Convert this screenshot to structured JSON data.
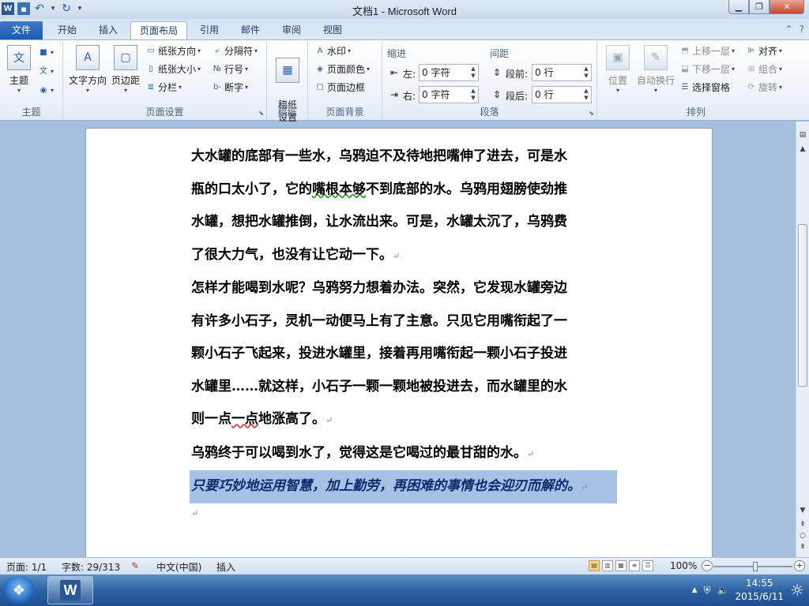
{
  "app": {
    "title": "文档1 - Microsoft Word",
    "logo_letter": "W"
  },
  "tabs": [
    "文件",
    "开始",
    "插入",
    "页面布局",
    "引用",
    "邮件",
    "审阅",
    "视图"
  ],
  "ribbon": {
    "theme": {
      "label": "主题",
      "group": "主题"
    },
    "page_setup": {
      "group": "页面设置",
      "text_direction": "文字方向",
      "margins": "页边距",
      "orientation": "纸张方向",
      "size": "纸张大小",
      "columns": "分栏",
      "breaks": "分隔符",
      "line_numbers": "行号",
      "hyphenation": "断字"
    },
    "manuscript": {
      "group": "稿纸",
      "button": "稿纸\n设置"
    },
    "page_background": {
      "group": "页面背景",
      "watermark": "水印",
      "page_color": "页面颜色",
      "page_borders": "页面边框"
    },
    "paragraph": {
      "group": "段落",
      "indent_head": "缩进",
      "spacing_head": "间距",
      "left_label": "左:",
      "right_label": "右:",
      "before_label": "段前:",
      "after_label": "段后:",
      "left_value": "0 字符",
      "right_value": "0 字符",
      "before_value": "0 行",
      "after_value": "0 行"
    },
    "arrange": {
      "group": "排列",
      "position": "位置",
      "wrap": "自动换行",
      "bring_forward": "上移一层",
      "send_backward": "下移一层",
      "selection_pane": "选择窗格",
      "align": "对齐",
      "group_btn": "组合",
      "rotate": "旋转"
    }
  },
  "document": {
    "lines_p1": [
      "大水罐的底部有一些水，乌鸦迫不及待地把嘴伸了进去，可是水",
      "瓶的口太小了，它的",
      "嘴根本够",
      "不到底部的水。乌鸦用翅膀使劲推",
      "水罐，想把水罐推倒，让水流出来。可是，水罐太沉了，乌鸦费",
      "了很大力气，也没有让它动一下。"
    ],
    "lines_p2": [
      "怎样才能喝到水呢？乌鸦努力想着办法。突然，它发现水罐旁边",
      "有许多小石子，灵机一动便马上有了主意。只见它用嘴衔起了一",
      "颗小石子飞起来，投进水罐里，接着再用嘴衔起一颗小石子投进",
      "水罐里……就这样，小石子一颗一颗地被投进去，而水罐里的水",
      "则一点",
      "一点",
      "地涨高了。"
    ],
    "p3": "乌鸦终于可以喝到水了，觉得这是它喝过的最甘甜的水。",
    "p4": "只要巧妙地运用智慧，加上勤劳，再困难的事情也会迎刃而解的。",
    "para_mark": "↵"
  },
  "status": {
    "page": "页面: 1/1",
    "words": "字数: 29/313",
    "language": "中文(中国)",
    "mode": "插入",
    "zoom": "100%"
  },
  "taskbar": {
    "time": "14:55",
    "date": "2015/6/11"
  }
}
